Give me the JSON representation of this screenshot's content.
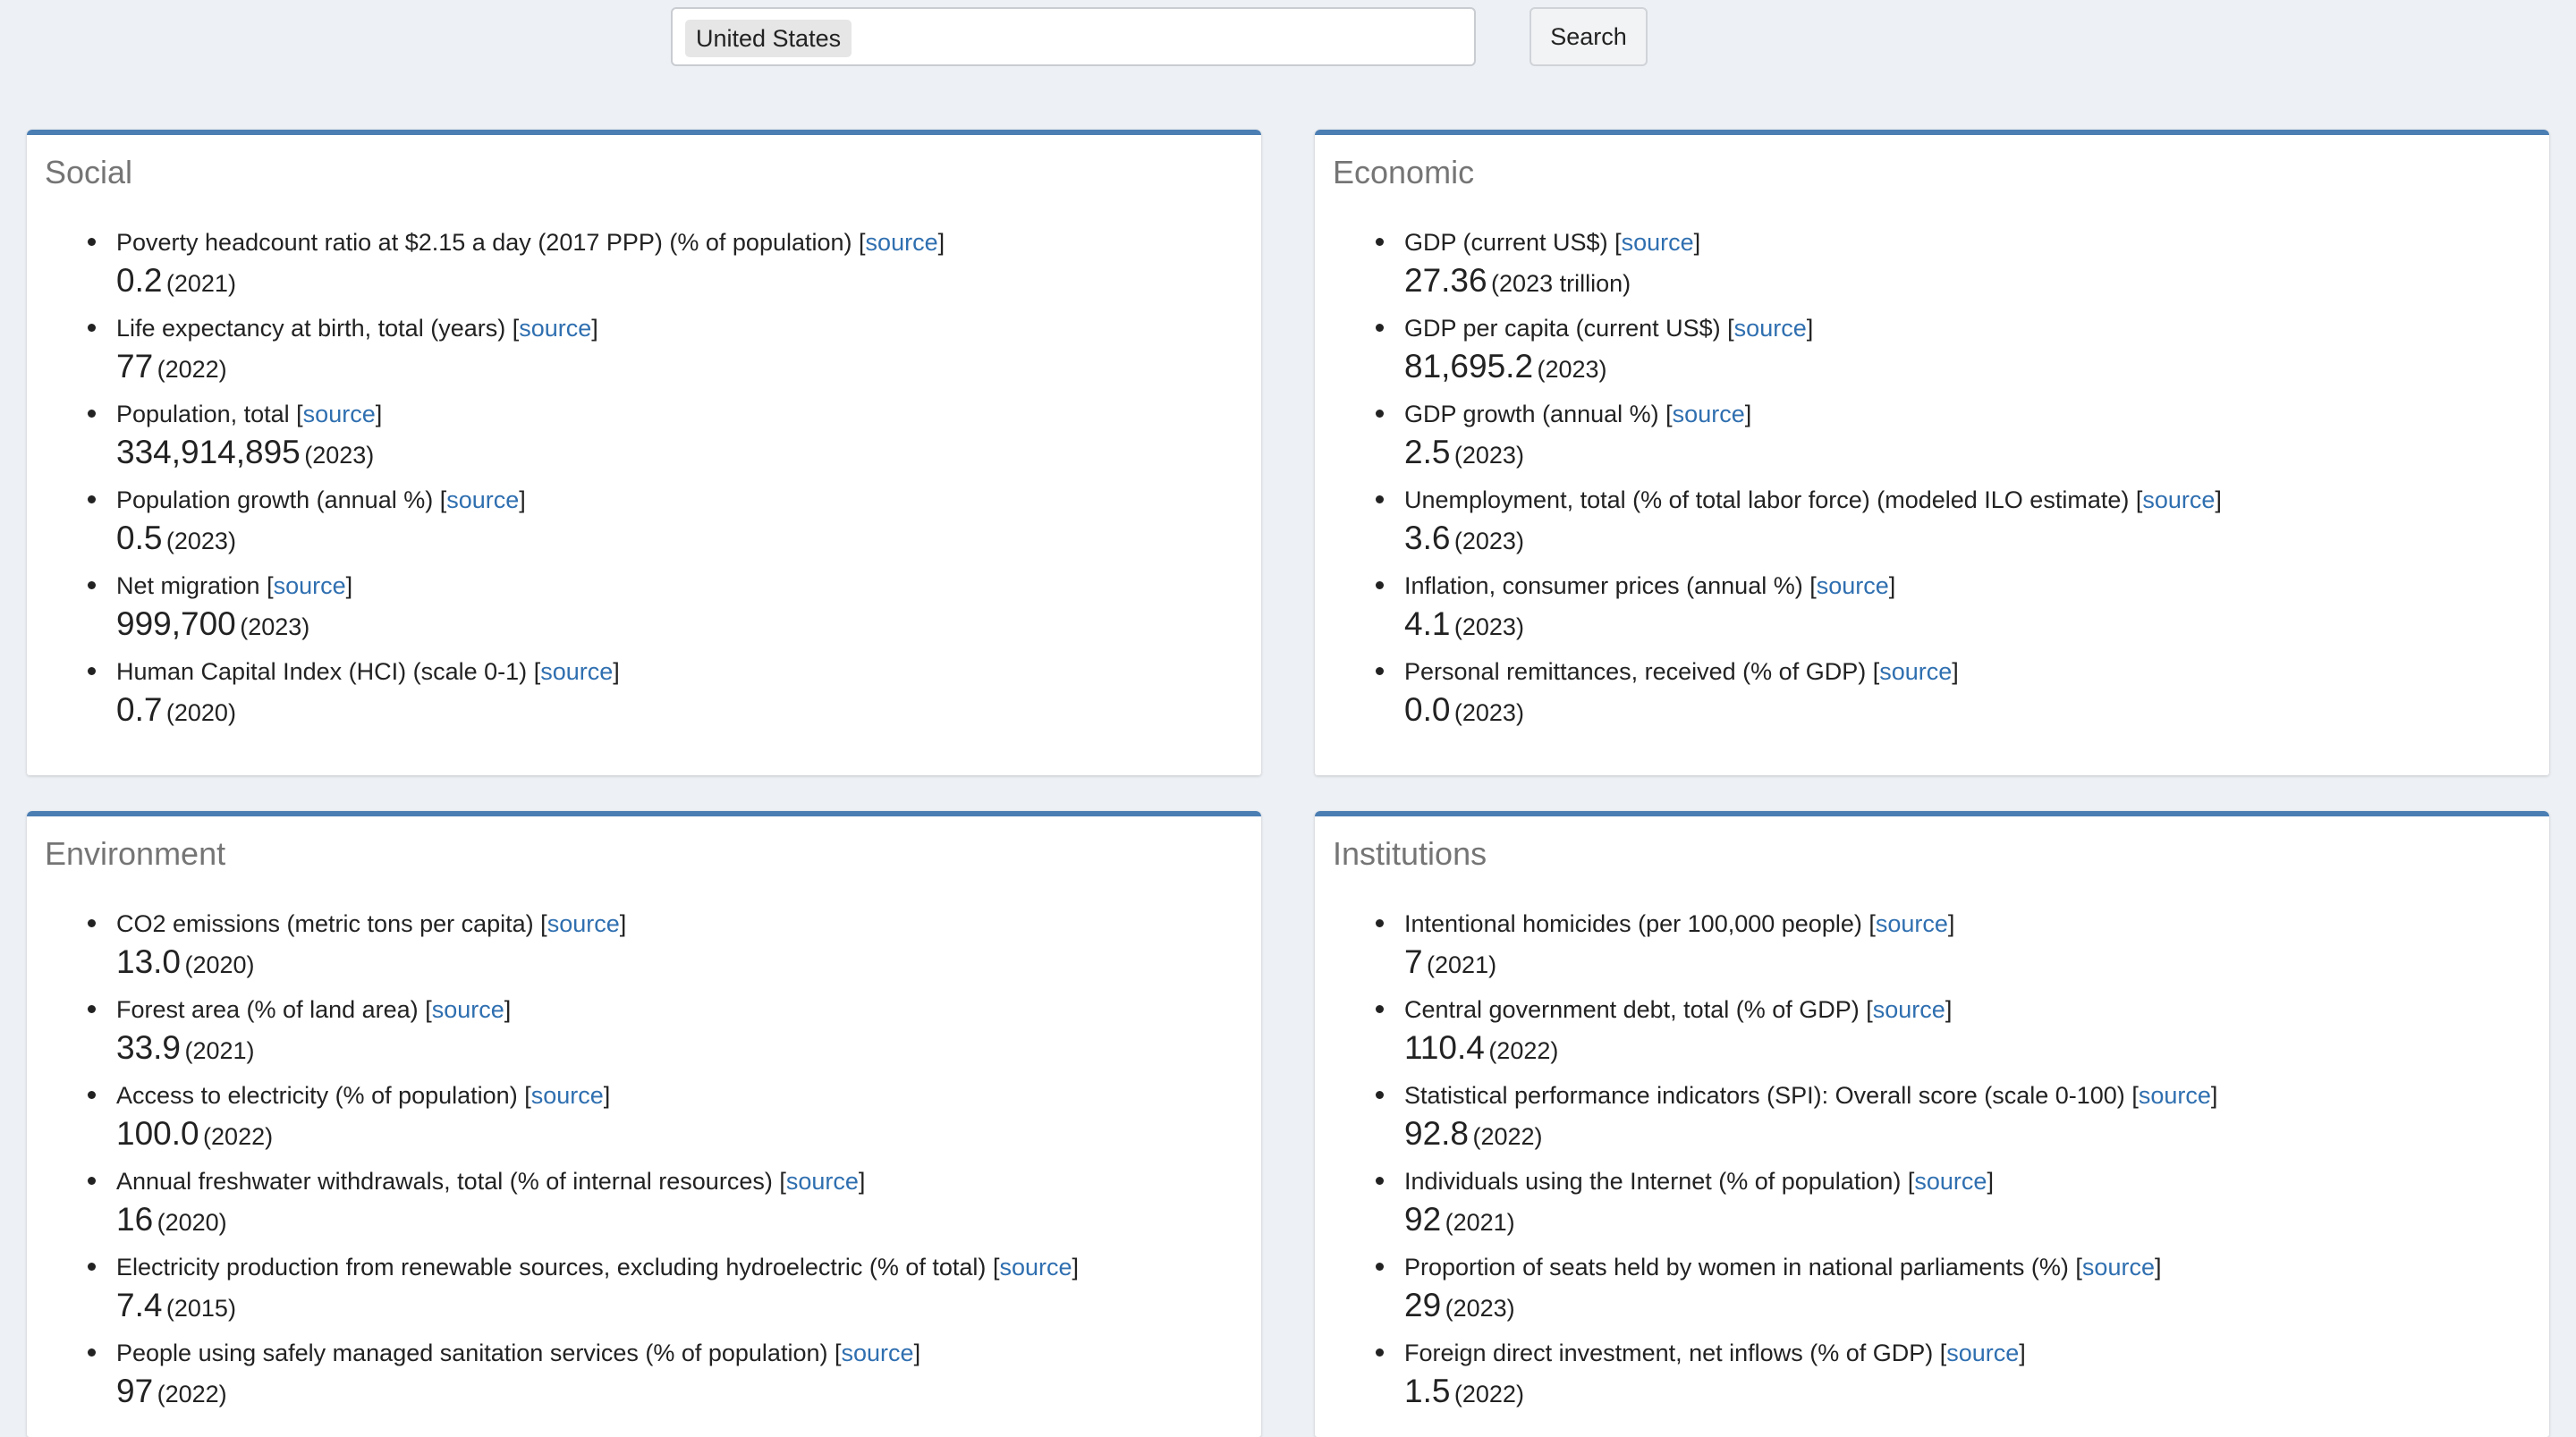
{
  "search": {
    "value": "United States",
    "button_label": "Search"
  },
  "source_link_text": "source",
  "panels": [
    {
      "title": "Social",
      "items": [
        {
          "label": "Poverty headcount ratio at $2.15 a day (2017 PPP) (% of population)",
          "value": "0.2",
          "year": "(2021)"
        },
        {
          "label": "Life expectancy at birth, total (years)",
          "value": "77",
          "year": "(2022)"
        },
        {
          "label": "Population, total",
          "value": "334,914,895",
          "year": "(2023)"
        },
        {
          "label": "Population growth (annual %)",
          "value": "0.5",
          "year": "(2023)"
        },
        {
          "label": "Net migration",
          "value": "999,700",
          "year": "(2023)"
        },
        {
          "label": "Human Capital Index (HCI) (scale 0-1)",
          "value": "0.7",
          "year": "(2020)"
        }
      ]
    },
    {
      "title": "Economic",
      "items": [
        {
          "label": "GDP (current US$)",
          "value": "27.36",
          "year": "(2023 trillion)"
        },
        {
          "label": "GDP per capita (current US$)",
          "value": "81,695.2",
          "year": "(2023)"
        },
        {
          "label": "GDP growth (annual %)",
          "value": "2.5",
          "year": "(2023)"
        },
        {
          "label": "Unemployment, total (% of total labor force) (modeled ILO estimate)",
          "value": "3.6",
          "year": "(2023)"
        },
        {
          "label": "Inflation, consumer prices (annual %)",
          "value": "4.1",
          "year": "(2023)"
        },
        {
          "label": "Personal remittances, received (% of GDP)",
          "value": "0.0",
          "year": "(2023)"
        }
      ]
    },
    {
      "title": "Environment",
      "items": [
        {
          "label": "CO2 emissions (metric tons per capita)",
          "value": "13.0",
          "year": "(2020)"
        },
        {
          "label": "Forest area (% of land area)",
          "value": "33.9",
          "year": "(2021)"
        },
        {
          "label": "Access to electricity (% of population)",
          "value": "100.0",
          "year": "(2022)"
        },
        {
          "label": "Annual freshwater withdrawals, total (% of internal resources)",
          "value": "16",
          "year": "(2020)"
        },
        {
          "label": "Electricity production from renewable sources, excluding hydroelectric (% of total)",
          "value": "7.4",
          "year": "(2015)"
        },
        {
          "label": "People using safely managed sanitation services (% of population)",
          "value": "97",
          "year": "(2022)"
        }
      ]
    },
    {
      "title": "Institutions",
      "items": [
        {
          "label": "Intentional homicides (per 100,000 people)",
          "value": "7",
          "year": "(2021)"
        },
        {
          "label": "Central government debt, total (% of GDP)",
          "value": "110.4",
          "year": "(2022)"
        },
        {
          "label": "Statistical performance indicators (SPI): Overall score (scale 0-100)",
          "value": "92.8",
          "year": "(2022)"
        },
        {
          "label": "Individuals using the Internet (% of population)",
          "value": "92",
          "year": "(2021)"
        },
        {
          "label": "Proportion of seats held by women in national parliaments (%)",
          "value": "29",
          "year": "(2023)"
        },
        {
          "label": "Foreign direct investment, net inflows (% of GDP)",
          "value": "1.5",
          "year": "(2022)"
        }
      ]
    }
  ]
}
